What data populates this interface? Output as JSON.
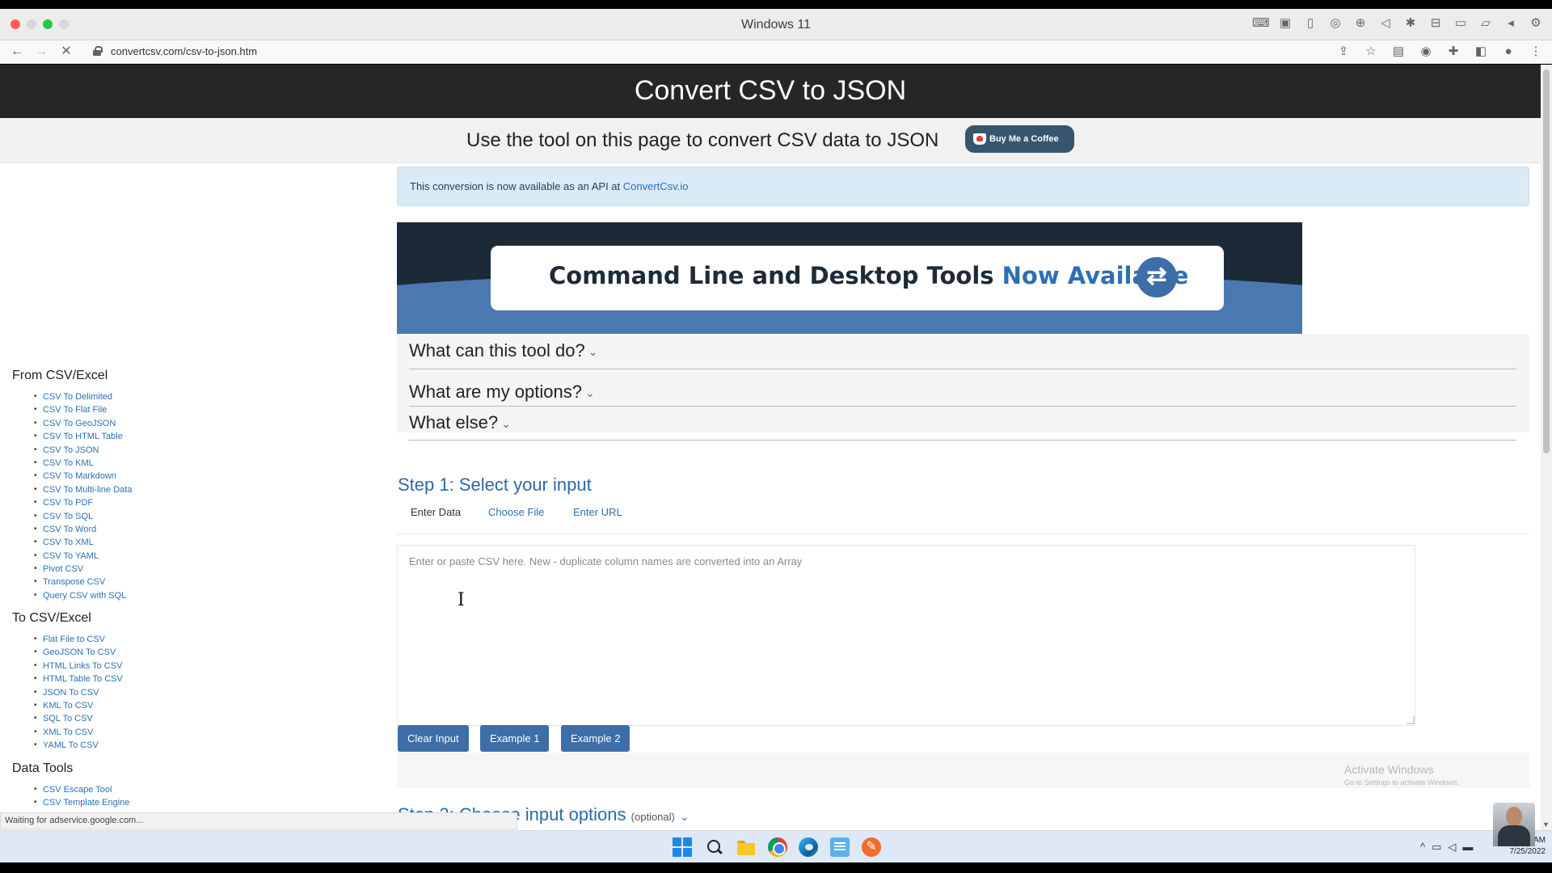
{
  "window": {
    "title": "Windows 11"
  },
  "browser": {
    "url": "convertcsv.com/csv-to-json.htm"
  },
  "site": {
    "title": "Convert CSV to JSON",
    "subtitle": "Use the tool on this page to convert CSV data to JSON",
    "coffee_button": "Buy Me a Coffee"
  },
  "api_notice": {
    "text": "This conversion is now available as an API at",
    "link": "ConvertCsv.io"
  },
  "banner": {
    "text": "Command Line and Desktop Tools",
    "highlight": "Now Available"
  },
  "accordion": [
    {
      "label": "What can this tool do?"
    },
    {
      "label": "What are my options?"
    },
    {
      "label": "What else?"
    }
  ],
  "step1": {
    "title": "Step 1: Select your input",
    "tabs": [
      "Enter Data",
      "Choose File",
      "Enter URL"
    ],
    "input_placeholder": "Enter or paste CSV here. New - duplicate column names are converted into an Array",
    "buttons": [
      "Clear Input",
      "Example 1",
      "Example 2"
    ]
  },
  "step2": {
    "title": "Step 2: Choose input options",
    "optional": "(optional)"
  },
  "watermark": {
    "line1": "Activate Windows",
    "line2": "Go to Settings to activate Windows."
  },
  "sidebar": {
    "sections": [
      {
        "heading": "From CSV/Excel",
        "items": [
          "CSV To Delimited",
          "CSV To Flat File",
          "CSV To GeoJSON",
          "CSV To HTML Table",
          "CSV To JSON",
          "CSV To KML",
          "CSV To Markdown",
          "CSV To Multi-line Data",
          "CSV To PDF",
          "CSV To SQL",
          "CSV To Word",
          "CSV To XML",
          "CSV To YAML",
          "Pivot CSV",
          "Transpose CSV",
          "Query CSV with SQL"
        ]
      },
      {
        "heading": "To CSV/Excel",
        "items": [
          "Flat File to CSV",
          "GeoJSON To CSV",
          "HTML Links To CSV",
          "HTML Table To CSV",
          "JSON To CSV",
          "KML To CSV",
          "SQL To CSV",
          "XML To CSV",
          "YAML To CSV"
        ]
      },
      {
        "heading": "Data Tools",
        "items": [
          "CSV Escape Tool",
          "CSV Template Engine"
        ]
      }
    ]
  },
  "status_bar": "Waiting for adservice.google.com...",
  "taskbar": {
    "time": "AM",
    "date": "7/25/2022"
  },
  "icons": {
    "window": [
      "close-icon",
      "minimize-icon",
      "maximize-icon",
      "fullscreen-icon"
    ],
    "browser": [
      "back-icon",
      "forward-icon",
      "stop-icon",
      "lock-icon",
      "share-icon",
      "star-icon",
      "extension-icon",
      "profile-icon",
      "menu-icon"
    ],
    "taskbar": [
      "windows-start-icon",
      "search-icon",
      "file-explorer-icon",
      "chrome-icon",
      "edge-icon",
      "notepad-icon",
      "brave-icon"
    ]
  },
  "colors": {
    "header": "#262626",
    "accent": "#3d6ea8",
    "link": "#2e6fb4",
    "notice_bg": "#dbeaf7"
  }
}
